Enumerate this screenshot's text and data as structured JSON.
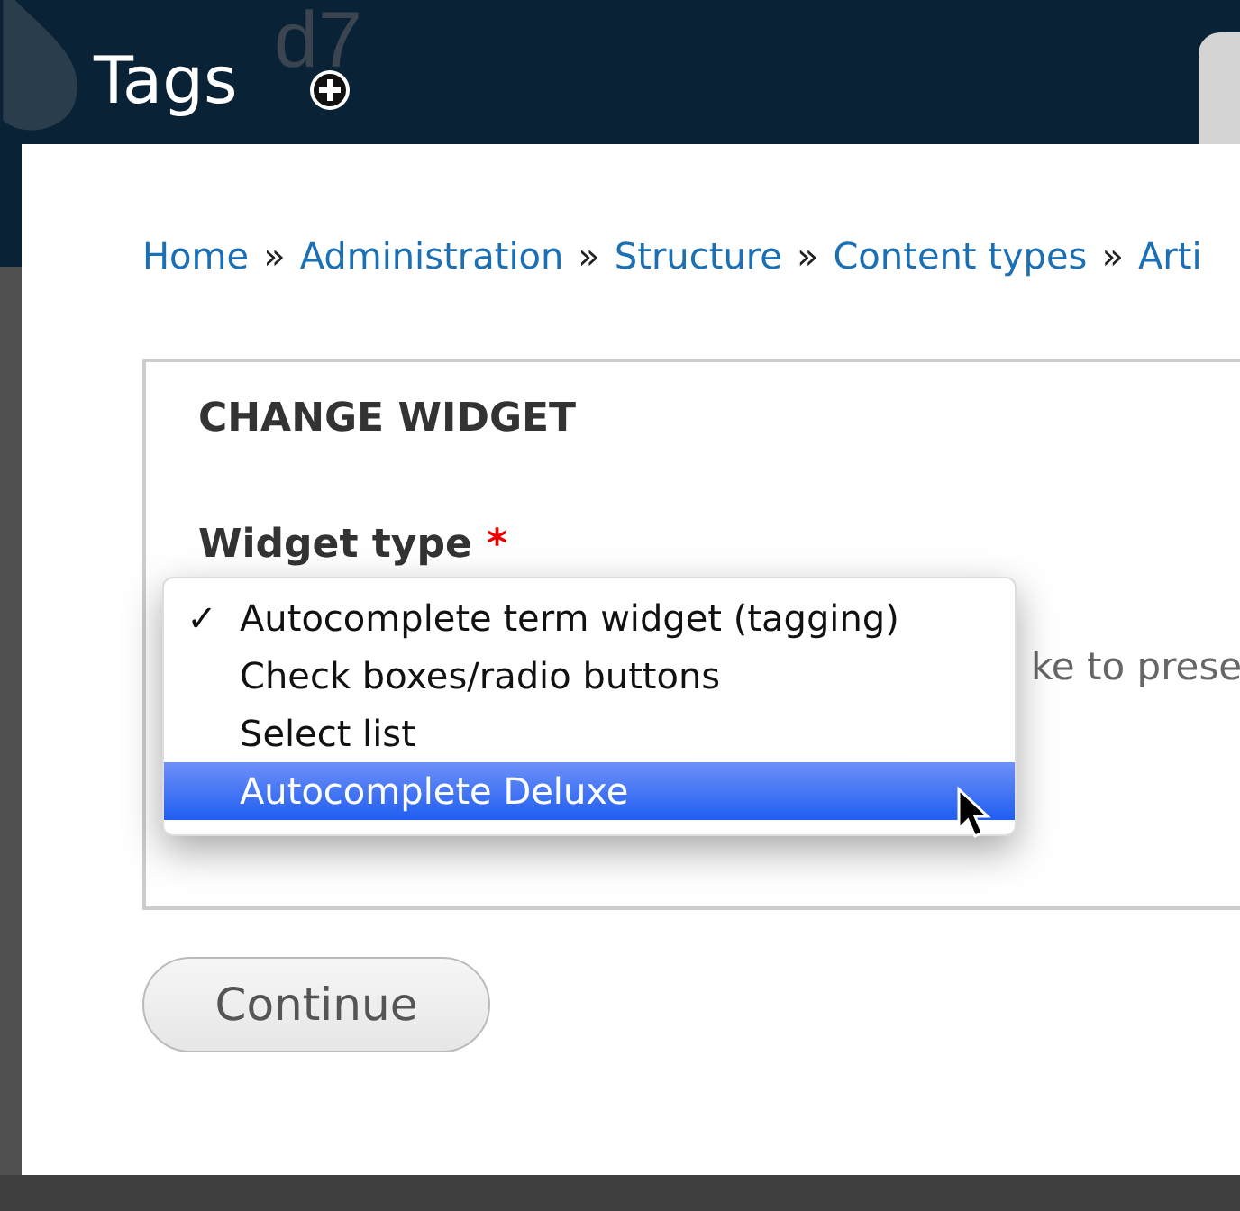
{
  "header": {
    "logo_text": "d7",
    "title": "Tags"
  },
  "breadcrumb": [
    "Home",
    "Administration",
    "Structure",
    "Content types",
    "Arti"
  ],
  "breadcrumb_separator": "»",
  "form": {
    "check_glyph": "✓",
    "legend": "CHANGE WIDGET",
    "field_label": "Widget type",
    "required_mark": "*",
    "description_visible_part": "ke to prese",
    "dropdown": [
      {
        "label": "Autocomplete term widget (tagging)",
        "checked": true,
        "selected": false
      },
      {
        "label": "Check boxes/radio buttons",
        "checked": false,
        "selected": false
      },
      {
        "label": "Select list",
        "checked": false,
        "selected": false
      },
      {
        "label": "Autocomplete Deluxe",
        "checked": false,
        "selected": true
      }
    ]
  },
  "buttons": [
    "Continue"
  ]
}
